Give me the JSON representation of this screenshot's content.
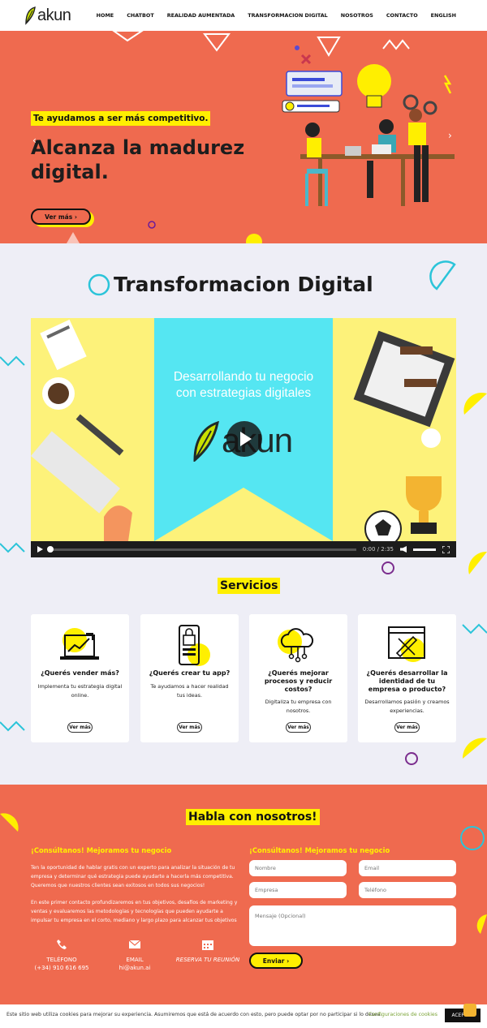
{
  "header": {
    "logo_text": "akun",
    "nav": [
      "HOME",
      "CHATBOT",
      "REALIDAD AUMENTADA",
      "TRANSFORMACION DIGITAL",
      "NOSOTROS",
      "CONTACTO",
      "ENGLISH"
    ]
  },
  "hero": {
    "tagline": "Te ayudamos a ser más competitivo.",
    "title": "Alcanza la madurez digital.",
    "button": "Ver más ›"
  },
  "transformacion": {
    "title": "Transformacion Digital",
    "video_heading_1": "Desarrollando tu negocio",
    "video_heading_2": "con estrategias digitales",
    "video_logo": "akun",
    "time": "0:00 / 2:35"
  },
  "servicios": {
    "title": "Servicios",
    "cards": [
      {
        "title": "¿Querés vender más?",
        "text": "Implementa tu estrategia digital online.",
        "button": "Ver más",
        "icon": "laptop-chart-icon"
      },
      {
        "title": "¿Querés crear tu app?",
        "text": "Te ayudamos a hacer realidad tus ideas.",
        "button": "Ver más",
        "icon": "smartphone-lock-icon"
      },
      {
        "title": "¿Querés mejorar procesos y reducir costos?",
        "text": "Digitaliza tu empresa con nosotros.",
        "button": "Ver más",
        "icon": "cloud-network-icon"
      },
      {
        "title": "¿Querés desarrollar la identidad de tu empresa o producto?",
        "text": "Desarrollamos pasión y creamos experiencias.",
        "button": "Ver más",
        "icon": "design-tools-icon"
      }
    ]
  },
  "contact": {
    "title": "Habla con nosotros!",
    "left_subtitle": "¡Consúltanos! Mejoramos tu negocio",
    "right_subtitle": "¡Consúltanos! Mejoramos tu negocio",
    "paragraph_1": "Ten la oportunidad de hablar gratis con un experto para analizar la situación de tu empresa y determinar qué estrategia puede ayudarte a hacerla más competitiva. Queremos que nuestros clientes sean exitosos en todos sus negocios!",
    "paragraph_2": "En este primer contacto profundizaremos en tus objetivos, desafíos de marketing y ventas y evaluaremos las metodologías y tecnologías que pueden ayudarte a impulsar tu empresa en el corto, mediano y largo plazo para alcanzar tus objetivos",
    "phone_label": "TELÉFONO",
    "phone_value": "(+34) 910 616 695",
    "email_label": "EMAIL",
    "email_value": "hi@akun.ai",
    "meeting_label": "RESERVA TU REUNIÓN",
    "fields": {
      "nombre": "Nombre",
      "email": "Email",
      "empresa": "Empresa",
      "telefono": "Teléfono",
      "mensaje": "Mensaje (Opcional)"
    },
    "send_button": "Enviar ›"
  },
  "cookie": {
    "text": "Este sitio web utiliza cookies para mejorar su experiencia. Asumiremos que está de acuerdo con esto, pero puede optar por no participar si lo desea.",
    "config": "Configuraciones de cookies",
    "accept": "ACEPTAR"
  },
  "colors": {
    "accent": "#ef6a4f",
    "highlight": "#ffef00",
    "cyan": "#55e6f2",
    "page_bg": "#eeeef6"
  }
}
